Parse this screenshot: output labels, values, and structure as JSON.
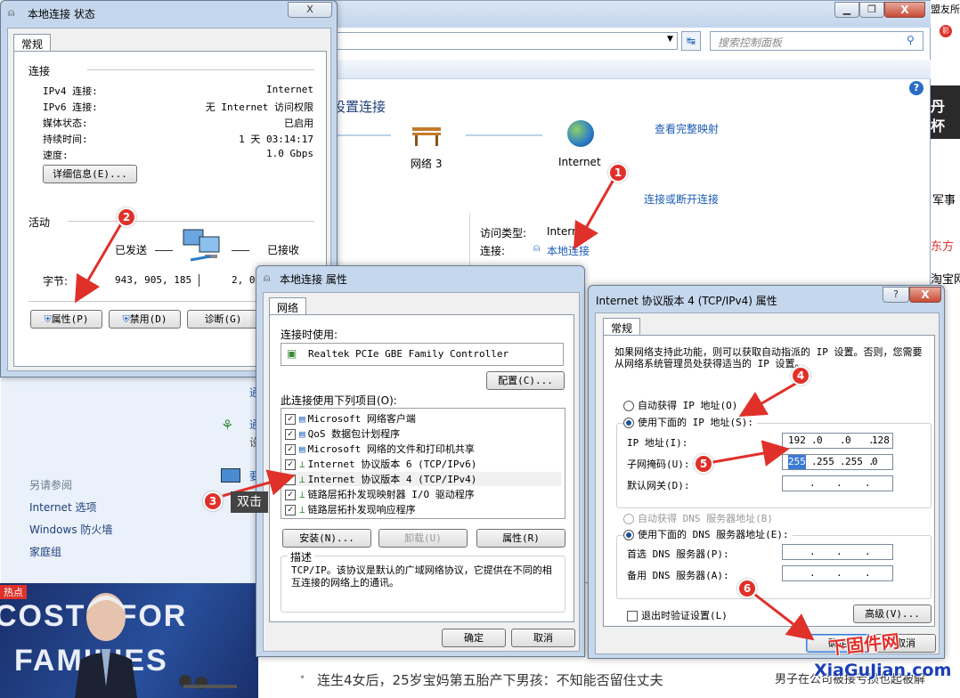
{
  "browser_right": {
    "top_text": "盟友所",
    "military": "军事",
    "east": "东方",
    "taobao": "淘宝网",
    "toolbar_icon": "影"
  },
  "control_panel": {
    "search_placeholder": "搜索控制面板",
    "help": "?",
    "heading": "设置连接",
    "view_full_map": "查看完整映射",
    "network_name": "网络 3",
    "internet_label": "Internet",
    "connect_disconnect": "连接或断开连接",
    "access_type_label": "访问类型:",
    "access_type_value": "Internet",
    "connection_label": "连接:",
    "connection_value": "本地连接",
    "see_also": "另请参阅",
    "see_also_items": [
      "Internet 选项",
      "Windows 防火墙",
      "家庭组"
    ],
    "side_letters": [
      "通",
      "设",
      "通",
      "设",
      "要"
    ]
  },
  "news": {
    "headline": "连生4女后，25岁宝妈第五胎产下男孩：不知能否留住丈夫",
    "right_headline": "男子在公司被接亏损也起被解",
    "thumb_tag": "热点",
    "thumb_text_line1": "COSTS FOR",
    "thumb_text_line2": "FAMILIES"
  },
  "status_window": {
    "title": "本地连接 状态",
    "close": "X",
    "tab": "常规",
    "connection_section": "连接",
    "rows": [
      {
        "label": "IPv4 连接:",
        "value": "Internet"
      },
      {
        "label": "IPv6 连接:",
        "value": "无 Internet 访问权限"
      },
      {
        "label": "媒体状态:",
        "value": "已启用"
      },
      {
        "label": "持续时间:",
        "value": "1 天 03:14:17"
      },
      {
        "label": "速度:",
        "value": "1.0 Gbps"
      }
    ],
    "details_button": "详细信息(E)...",
    "activity_section": "活动",
    "sent_label": "已发送",
    "received_label": "已接收",
    "bytes_label": "字节:",
    "bytes_sent": "943, 905, 185",
    "bytes_received": "2, 050",
    "properties_button": "属性(P)",
    "disable_button": "禁用(D)",
    "diagnose_button": "诊断(G)"
  },
  "props_window": {
    "title": "本地连接 属性",
    "tab": "网络",
    "connect_using_label": "连接时使用:",
    "adapter": "Realtek PCIe GBE Family Controller",
    "configure_button": "配置(C)...",
    "items_label": "此连接使用下列项目(O):",
    "items": [
      "Microsoft 网络客户端",
      "QoS 数据包计划程序",
      "Microsoft 网络的文件和打印机共享",
      "Internet 协议版本 6 (TCP/IPv6)",
      "Internet 协议版本 4 (TCP/IPv4)",
      "链路层拓扑发现映射器 I/O 驱动程序",
      "链路层拓扑发现响应程序"
    ],
    "check_mark": "✓",
    "install_button": "安装(N)...",
    "uninstall_button": "卸载(U)",
    "properties_button": "属性(R)",
    "description_label": "描述",
    "description": "TCP/IP。该协议是默认的广域网络协议，它提供在不同的相互连接的网络上的通讯。",
    "ok_button": "确定",
    "cancel_button": "取消"
  },
  "ipv4_window": {
    "title": "Internet 协议版本 4 (TCP/IPv4) 属性",
    "help": "?",
    "close": "X",
    "tab": "常规",
    "intro": "如果网络支持此功能，则可以获取自动指派的 IP 设置。否则，您需要从网络系统管理员处获得适当的 IP 设置。",
    "auto_ip": "自动获得 IP 地址(O)",
    "use_ip": "使用下面的 IP 地址(S):",
    "ip_label": "IP 地址(I):",
    "ip_octets": [
      "192",
      "0",
      "0",
      "128"
    ],
    "mask_label": "子网掩码(U):",
    "mask_octets": [
      "255",
      "255",
      "255",
      "0"
    ],
    "gateway_label": "默认网关(D):",
    "auto_dns": "自动获得 DNS 服务器地址(B)",
    "use_dns": "使用下面的 DNS 服务器地址(E):",
    "dns1_label": "首选 DNS 服务器(P):",
    "dns2_label": "备用 DNS 服务器(A):",
    "validate_label": "退出时验证设置(L)",
    "advanced_button": "高级(V)...",
    "ok_button": "确定",
    "cancel_button": "取消"
  },
  "annotations": {
    "badges": [
      "1",
      "2",
      "3",
      "4",
      "5",
      "6"
    ],
    "double_click_hint": "双击",
    "watermark_title": "下固件网",
    "watermark_url": "XiaGuJian.com",
    "accent_red": "#e0302a"
  }
}
